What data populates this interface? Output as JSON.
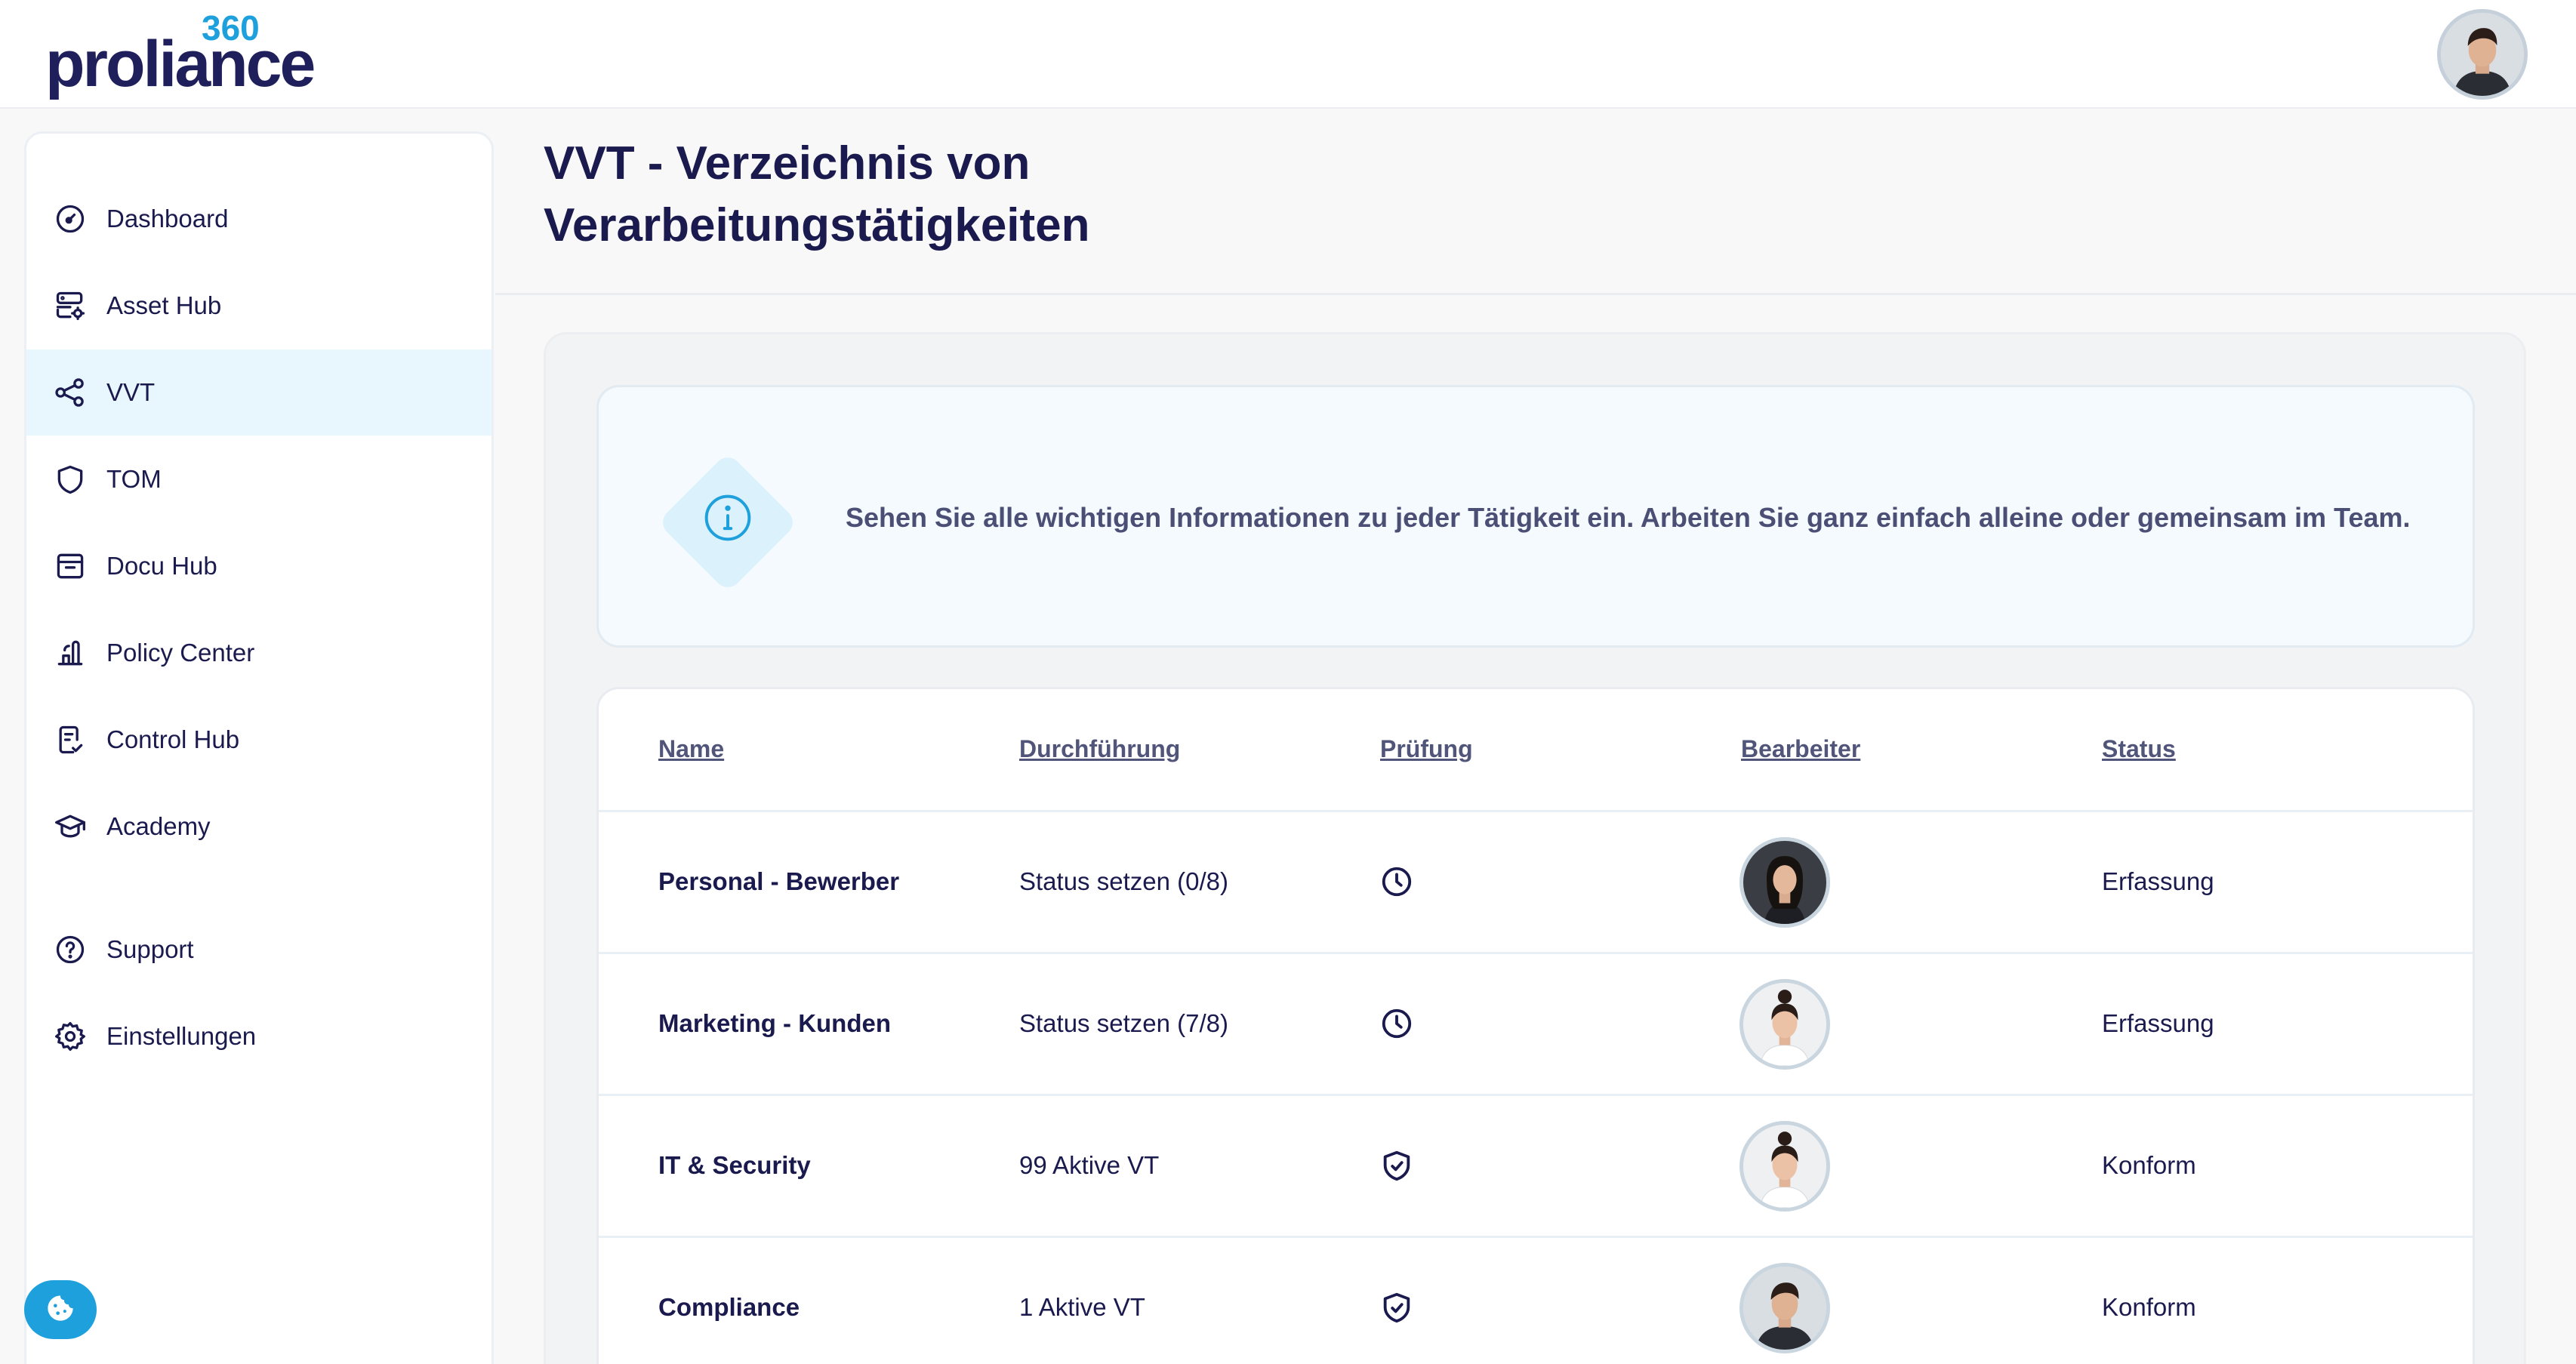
{
  "brand": {
    "name": "proliance",
    "superscript": "360",
    "colors": {
      "primary": "#1f1f5c",
      "accent": "#1ea0dc",
      "active_bg": "#e8f6fd"
    }
  },
  "header": {
    "avatar_icon": "user-avatar"
  },
  "sidebar": {
    "items": [
      {
        "label": "Dashboard",
        "icon": "dashboard-gauge-icon"
      },
      {
        "label": "Asset Hub",
        "icon": "server-gear-icon"
      },
      {
        "label": "VVT",
        "icon": "share-nodes-icon",
        "active": true
      },
      {
        "label": "TOM",
        "icon": "shield-icon"
      },
      {
        "label": "Docu Hub",
        "icon": "archive-box-icon"
      },
      {
        "label": "Policy Center",
        "icon": "policy-icon"
      },
      {
        "label": "Control Hub",
        "icon": "checklist-icon"
      },
      {
        "label": "Academy",
        "icon": "graduation-cap-icon"
      },
      {
        "label": "Support",
        "icon": "question-circle-icon"
      },
      {
        "label": "Einstellungen",
        "icon": "gear-icon"
      }
    ]
  },
  "page": {
    "title_line1": "VVT - Verzeichnis von",
    "title_line2": "Verarbeitungstätigkeiten"
  },
  "info": {
    "text": "Sehen Sie alle wichtigen Informationen zu jeder Tätigkeit ein. Arbeiten Sie ganz einfach alleine oder gemeinsam im Team."
  },
  "table": {
    "columns": [
      "Name",
      "Durchführung",
      "Prüfung",
      "Bearbeiter",
      "Status"
    ],
    "rows": [
      {
        "name": "Personal - Bewerber",
        "execution": "Status setzen (0/8)",
        "check_icon": "clock-icon",
        "editor": "woman-dark-hair-avatar",
        "status": "Erfassung"
      },
      {
        "name": "Marketing - Kunden",
        "execution": "Status setzen (7/8)",
        "check_icon": "clock-icon",
        "editor": "woman-bun-avatar",
        "status": "Erfassung"
      },
      {
        "name": "IT & Security",
        "execution": "99 Aktive VT",
        "check_icon": "shield-check-icon",
        "editor": "woman-bun-avatar",
        "status": "Konform"
      },
      {
        "name": "Compliance",
        "execution": "1 Aktive VT",
        "check_icon": "shield-check-icon",
        "editor": "man-avatar",
        "status": "Konform"
      }
    ]
  },
  "cookie": {
    "icon": "cookie-icon"
  }
}
